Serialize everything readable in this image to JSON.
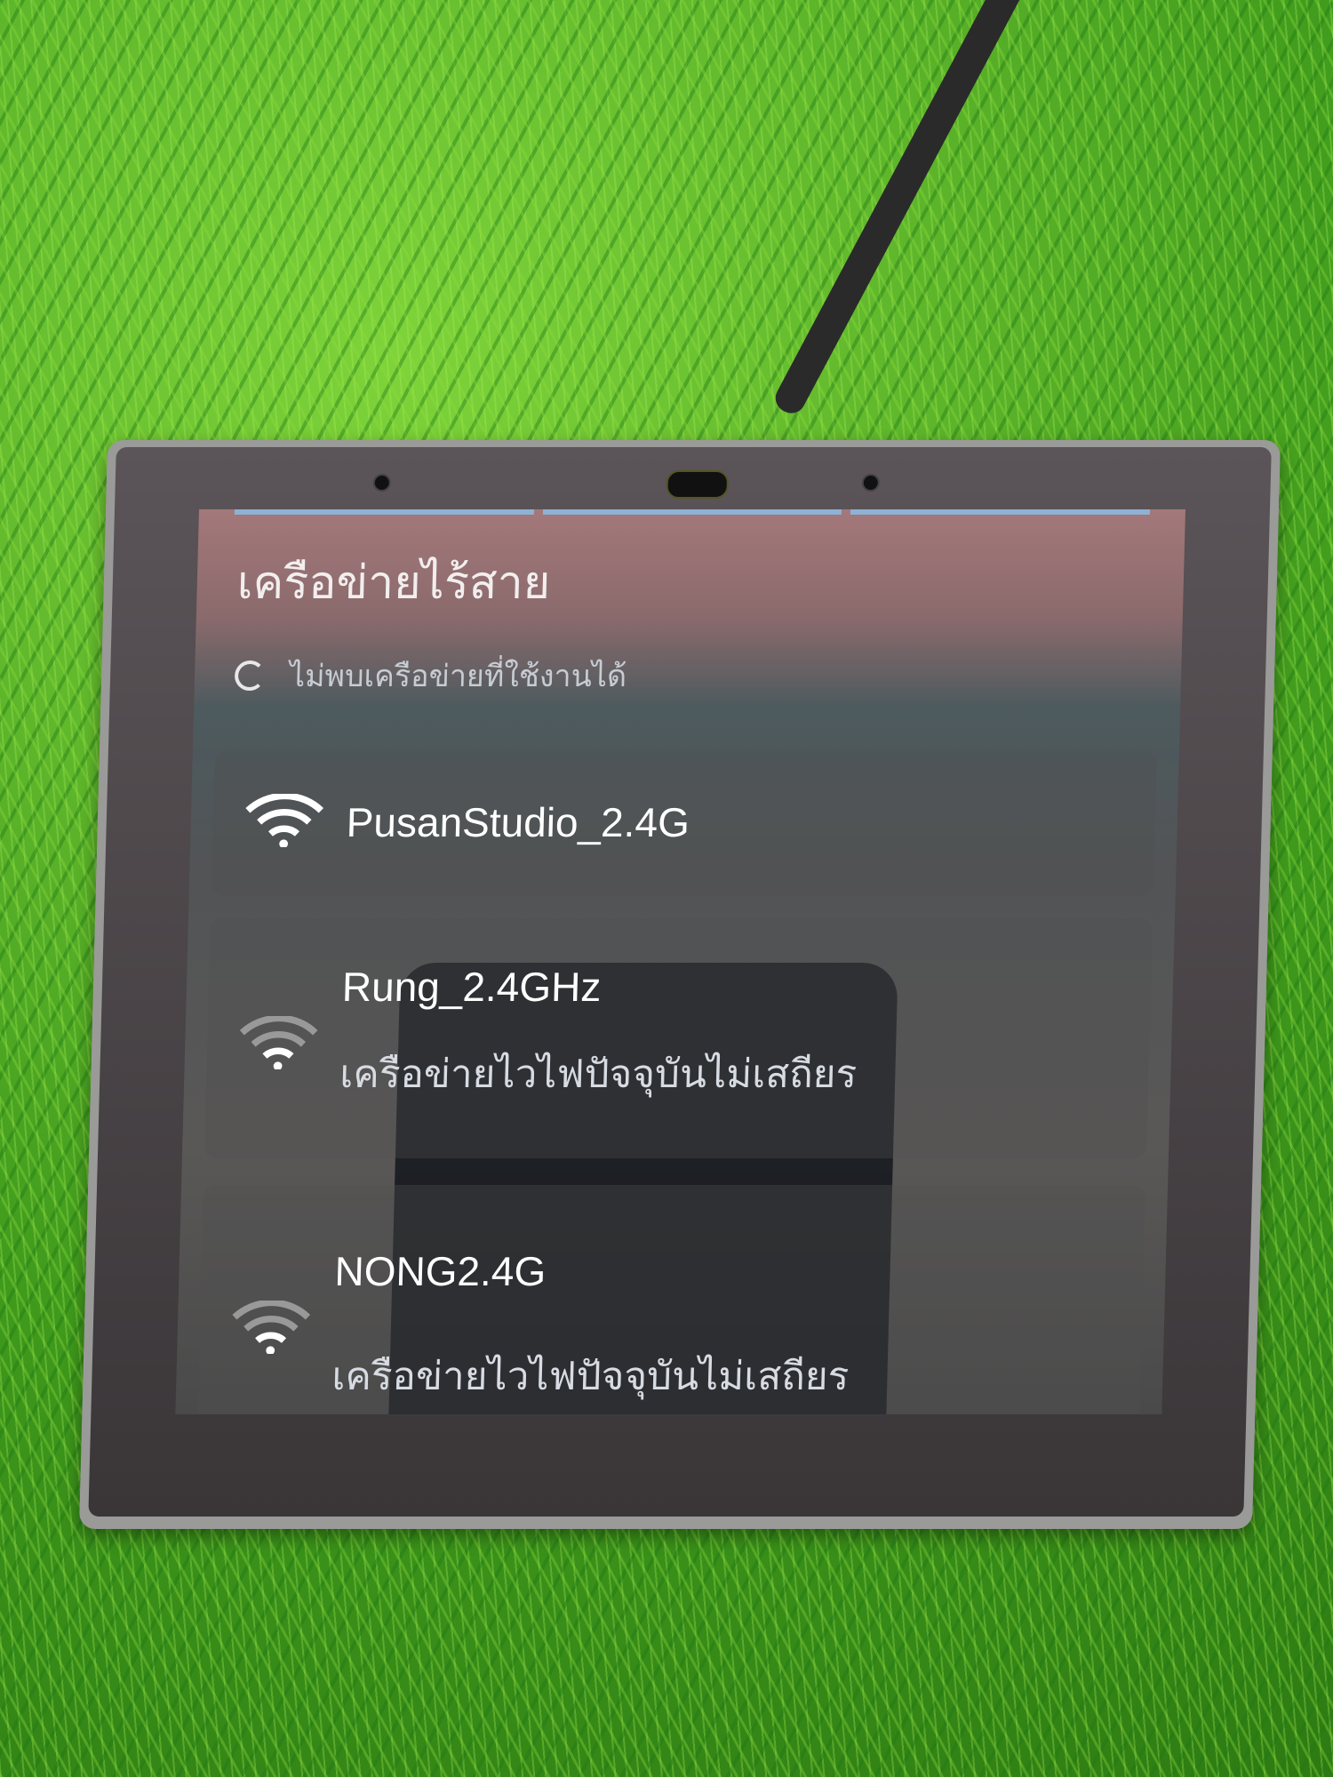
{
  "screen": {
    "title": "เครือข่ายไร้สาย",
    "scan_status": "ไม่พบเครือข่ายที่ใช้งานได้",
    "networks": [
      {
        "ssid": "PusanStudio_2.4G",
        "status": "",
        "signal": "full"
      },
      {
        "ssid": "Rung_2.4GHz",
        "status": "เครือข่ายไวไฟปัจจุบันไม่เสถียร",
        "signal": "weak"
      },
      {
        "ssid": "NONG2.4G",
        "status": "เครือข่ายไวไฟปัจจุบันไม่เสถียร",
        "signal": "weak"
      }
    ]
  },
  "colors": {
    "progress": "#8fb1d4",
    "text": "#ffffff"
  }
}
